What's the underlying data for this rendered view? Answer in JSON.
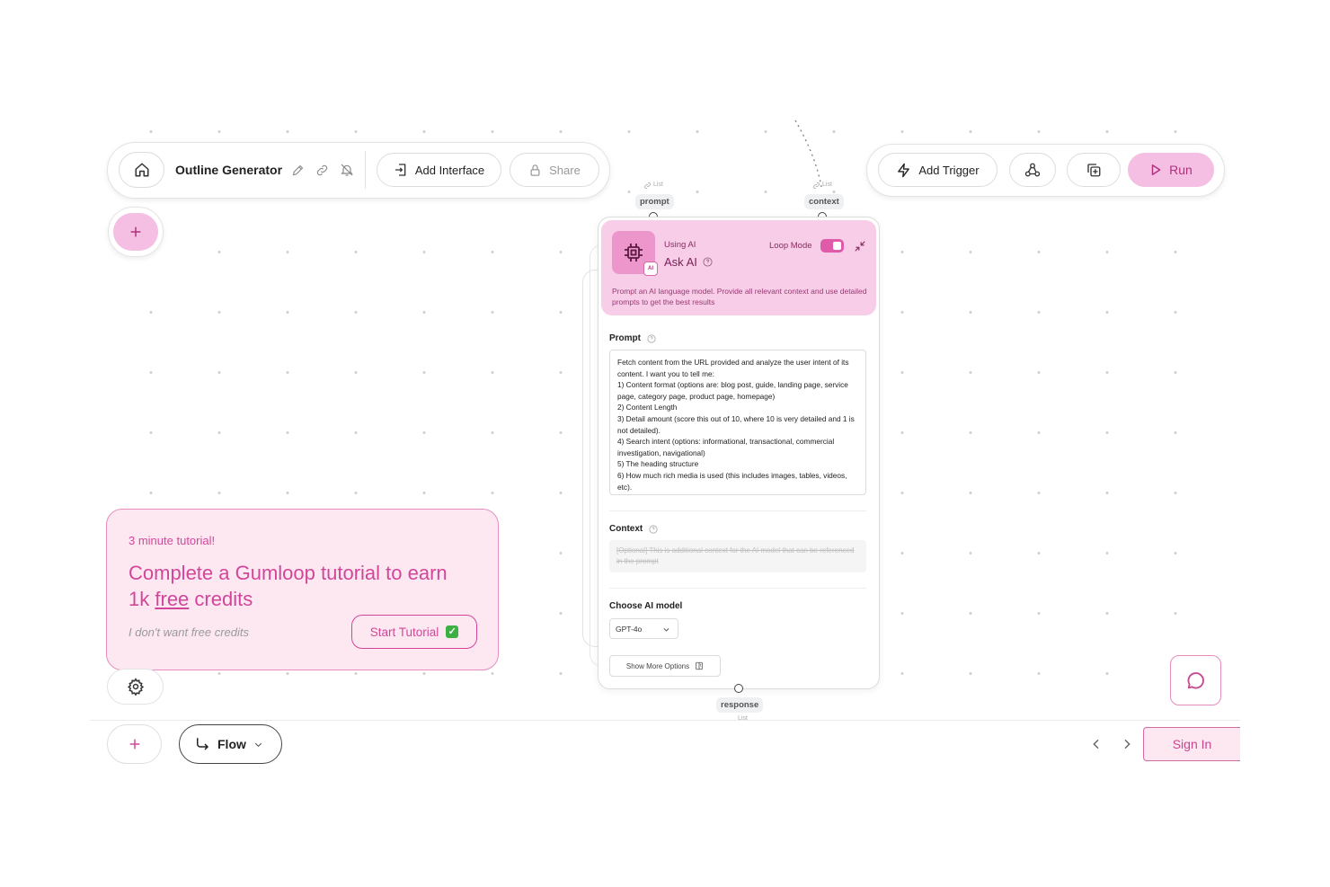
{
  "header": {
    "title": "Outline Generator",
    "add_interface_label": "Add Interface",
    "share_label": "Share",
    "add_trigger_label": "Add Trigger",
    "run_label": "Run"
  },
  "node": {
    "subtitle": "Using AI",
    "title": "Ask AI",
    "loop_mode_label": "Loop Mode",
    "loop_mode_on": true,
    "description": "Prompt an AI language model. Provide all relevant context and use detailed prompts to get the best results",
    "inputs": [
      {
        "name": "prompt",
        "type": "List"
      },
      {
        "name": "context",
        "type": "List"
      }
    ],
    "output": {
      "name": "response",
      "type": "List"
    },
    "prompt_label": "Prompt",
    "prompt_value": "Fetch content from the URL provided and analyze the user intent of its content. I want you to tell me:\n1) Content format (options are: blog post, guide, landing page, service page, category page, product page, homepage)\n2) Content Length\n3) Detail amount (score this out of 10, where 10 is very detailed and 1 is not detailed).\n4) Search intent (options: informational, transactional, commercial investigation, navigational)\n5) The heading structure\n6) How much rich media is used (this includes images, tables, videos, etc).",
    "context_label": "Context",
    "context_placeholder": "[Optional] This is additional context for the AI model that can be referenced in the prompt",
    "model_label": "Choose AI model",
    "model_value": "GPT-4o",
    "show_more_label": "Show More Options",
    "ai_badge": "AI"
  },
  "tutorial": {
    "kicker": "3 minute tutorial!",
    "headline_part1": "Complete a Gumloop tutorial to earn",
    "headline_part2": "1k",
    "headline_free": "free",
    "headline_part3": "credits",
    "decline_label": "I don't want free credits",
    "start_label": "Start Tutorial",
    "start_emoji": "✅"
  },
  "bottom_bar": {
    "flow_label": "Flow",
    "sign_in_label": "Sign In"
  },
  "colors": {
    "accent_pink": "#f4bfe3",
    "node_header_bg": "#f7cde8",
    "tutorial_bg": "#fde8f2",
    "tutorial_text": "#d2469a",
    "sign_in_border": "#d46aa6"
  }
}
